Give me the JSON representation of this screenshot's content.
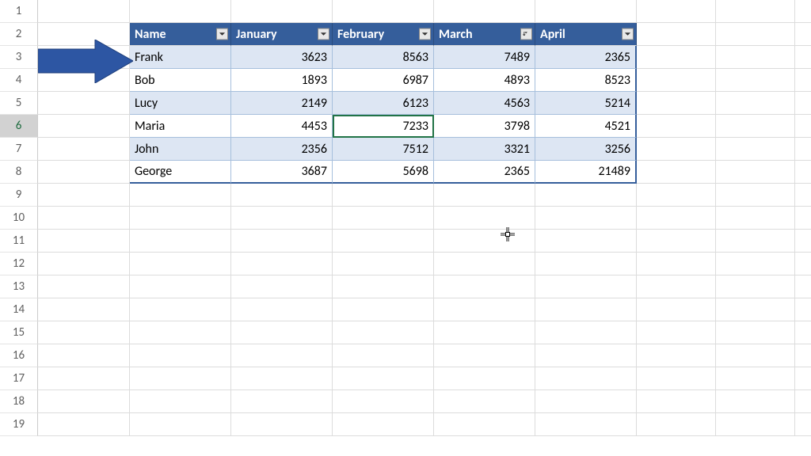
{
  "rows_visible": [
    "1",
    "2",
    "3",
    "4",
    "5",
    "6",
    "7",
    "8",
    "9",
    "10",
    "11",
    "12",
    "13",
    "14",
    "15",
    "16",
    "17",
    "18",
    "19"
  ],
  "headers": [
    "Name",
    "January",
    "February",
    "March",
    "April"
  ],
  "data": [
    {
      "name": "Frank",
      "january": 3623,
      "february": 8563,
      "march": 7489,
      "april": 2365
    },
    {
      "name": "Bob",
      "january": 1893,
      "february": 6987,
      "march": 4893,
      "april": 8523
    },
    {
      "name": "Lucy",
      "january": 2149,
      "february": 6123,
      "march": 4563,
      "april": 5214
    },
    {
      "name": "Maria",
      "january": 4453,
      "february": 7233,
      "march": 3798,
      "april": 4521
    },
    {
      "name": "John",
      "january": 2356,
      "february": 7512,
      "march": 3321,
      "april": 3256
    },
    {
      "name": "George",
      "january": 3687,
      "february": 5698,
      "march": 2365,
      "april": 21489
    }
  ],
  "header_row_index": 1,
  "data_start_row_index": 2,
  "selected_cell": {
    "row_index": 5,
    "col": "february"
  },
  "active_row": "6"
}
